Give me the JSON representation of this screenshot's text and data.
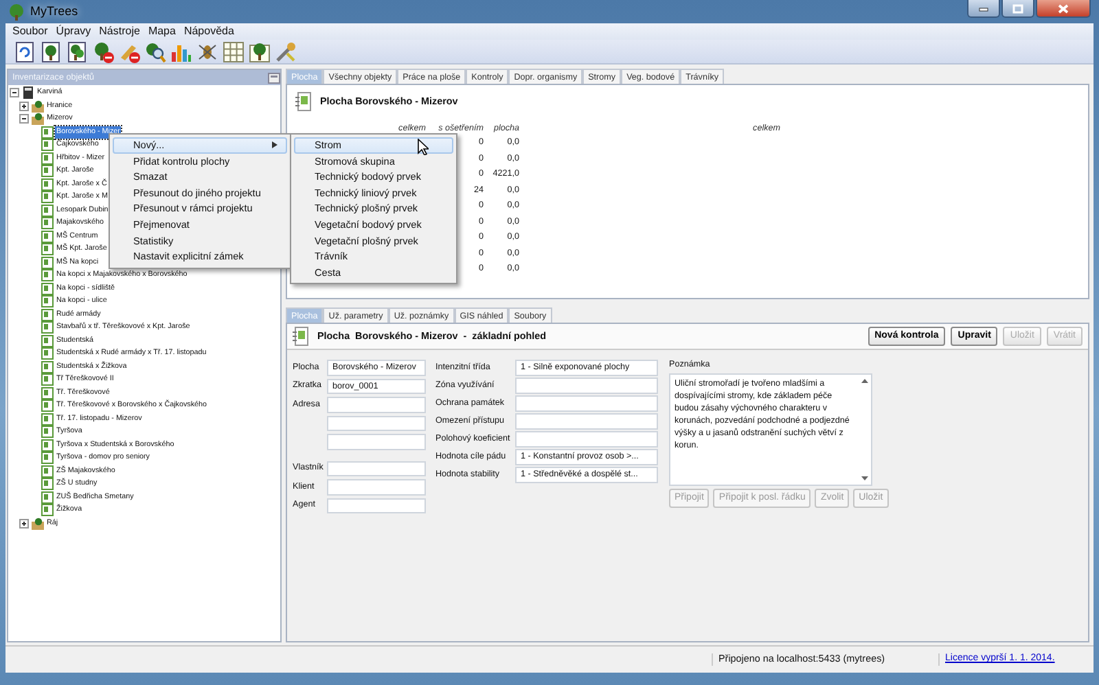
{
  "window": {
    "title": "MyTrees"
  },
  "menu_bar": [
    {
      "label": "Soubor"
    },
    {
      "label": "Úpravy"
    },
    {
      "label": "Nástroje"
    },
    {
      "label": "Mapa"
    },
    {
      "label": "Nápověda"
    }
  ],
  "tree_panel": {
    "title": "Inventarizace objektů",
    "tree": [
      {
        "label": "Karviná",
        "kind": "root",
        "expanded": true,
        "selected": false,
        "children": [
          {
            "label": "Hranice",
            "kind": "district",
            "expanded": false,
            "selected": false
          },
          {
            "label": "Mizerov",
            "kind": "district",
            "expanded": true,
            "selected": false,
            "children": [
              {
                "label": "Borovského - Mizer",
                "kind": "area",
                "selected": true
              },
              {
                "label": "Čajkovského",
                "kind": "area",
                "selected": false
              },
              {
                "label": "Hřbitov - Mizer",
                "kind": "area",
                "selected": false
              },
              {
                "label": "Kpt. Jaroše",
                "kind": "area",
                "selected": false
              },
              {
                "label": "Kpt. Jaroše x Č",
                "kind": "area",
                "selected": false
              },
              {
                "label": "Kpt. Jaroše x M",
                "kind": "area",
                "selected": false
              },
              {
                "label": "Lesopark Dubin",
                "kind": "area",
                "selected": false
              },
              {
                "label": "Majakovského",
                "kind": "area",
                "selected": false
              },
              {
                "label": "MŠ Centrum",
                "kind": "area",
                "selected": false
              },
              {
                "label": "MŠ Kpt. Jaroše",
                "kind": "area",
                "selected": false
              },
              {
                "label": "MŠ Na kopci",
                "kind": "area",
                "selected": false
              },
              {
                "label": "Na kopci x Majakovského x Borovského",
                "kind": "area",
                "selected": false
              },
              {
                "label": "Na kopci - sídliště",
                "kind": "area",
                "selected": false
              },
              {
                "label": "Na kopci - ulice",
                "kind": "area",
                "selected": false
              },
              {
                "label": "Rudé armády",
                "kind": "area",
                "selected": false
              },
              {
                "label": "Stavbařů x tř. Těreškovové x Kpt. Jaroše",
                "kind": "area",
                "selected": false
              },
              {
                "label": "Studentská",
                "kind": "area",
                "selected": false
              },
              {
                "label": "Studentská x Rudé armády x Tř. 17. listopadu",
                "kind": "area",
                "selected": false
              },
              {
                "label": "Studentská x Žižkova",
                "kind": "area",
                "selected": false
              },
              {
                "label": "Tř Těreškovové II",
                "kind": "area",
                "selected": false
              },
              {
                "label": "Tř. Těreškovové",
                "kind": "area",
                "selected": false
              },
              {
                "label": "Tř. Těreškovové x Borovského x Čajkovského",
                "kind": "area",
                "selected": false
              },
              {
                "label": "Tř. 17. listopadu - Mizerov",
                "kind": "area",
                "selected": false
              },
              {
                "label": "Tyršova",
                "kind": "area",
                "selected": false
              },
              {
                "label": "Tyršova x Studentská x Borovského",
                "kind": "area",
                "selected": false
              },
              {
                "label": "Tyršova - domov pro seniory",
                "kind": "area",
                "selected": false
              },
              {
                "label": "ZŠ Majakovského",
                "kind": "area",
                "selected": false
              },
              {
                "label": "ZŠ U studny",
                "kind": "area",
                "selected": false
              },
              {
                "label": "ZUŠ Bedřicha Smetany",
                "kind": "area",
                "selected": false
              },
              {
                "label": "Žižkova",
                "kind": "area",
                "selected": false
              }
            ]
          },
          {
            "label": "Ráj",
            "kind": "district",
            "expanded": false,
            "selected": false
          }
        ]
      }
    ]
  },
  "top_tabs": [
    {
      "label": "Plocha",
      "selected": true
    },
    {
      "label": "Všechny objekty",
      "selected": false
    },
    {
      "label": "Práce na ploše",
      "selected": false
    },
    {
      "label": "Kontroly",
      "selected": false
    },
    {
      "label": "Dopr. organismy",
      "selected": false
    },
    {
      "label": "Stromy",
      "selected": false
    },
    {
      "label": "Veg. bodové",
      "selected": false
    },
    {
      "label": "Trávníky",
      "selected": false
    }
  ],
  "area_header": {
    "title": "Plocha Borovského - Mizerov"
  },
  "summary_table": {
    "columns": [
      "celkem",
      "s ošetřením",
      "plocha"
    ],
    "column_4": "celkem",
    "rows": [
      {
        "treated": "0",
        "area": "0,0"
      },
      {
        "treated": "0",
        "area": "0,0"
      },
      {
        "treated": "0",
        "area": "4221,0"
      },
      {
        "treated": "24",
        "area": "0,0"
      },
      {
        "treated": "0",
        "area": "0,0"
      },
      {
        "treated": "0",
        "area": "0,0"
      },
      {
        "treated": "0",
        "area": "0,0"
      },
      {
        "treated": "0",
        "area": "0,0"
      },
      {
        "treated": "0",
        "area": "0,0"
      }
    ]
  },
  "context_menu": {
    "items": [
      {
        "label": "Nový...",
        "has_submenu": true,
        "selected": true
      },
      {
        "label": "Přidat kontrolu plochy",
        "has_submenu": false,
        "selected": false
      },
      {
        "label": "Smazat",
        "has_submenu": false,
        "selected": false
      },
      {
        "label": "Přesunout do jiného projektu",
        "has_submenu": false,
        "selected": false
      },
      {
        "label": "Přesunout v rámci projektu",
        "has_submenu": false,
        "selected": false
      },
      {
        "label": "Přejmenovat",
        "has_submenu": false,
        "selected": false
      },
      {
        "label": "Statistiky",
        "has_submenu": false,
        "selected": false
      },
      {
        "label": "Nastavit explicitní zámek",
        "has_submenu": false,
        "selected": false
      }
    ]
  },
  "submenu": {
    "items": [
      {
        "label": "Strom",
        "selected": true
      },
      {
        "label": "Stromová skupina",
        "selected": false
      },
      {
        "label": "Technický bodový prvek",
        "selected": false
      },
      {
        "label": "Technický liniový prvek",
        "selected": false
      },
      {
        "label": "Technický plošný prvek",
        "selected": false
      },
      {
        "label": "Vegetační bodový prvek",
        "selected": false
      },
      {
        "label": "Vegetační plošný prvek",
        "selected": false
      },
      {
        "label": "Trávník",
        "selected": false
      },
      {
        "label": "Cesta",
        "selected": false
      }
    ]
  },
  "bottom_tabs": [
    {
      "label": "Plocha",
      "selected": true
    },
    {
      "label": "Už. parametry",
      "selected": false
    },
    {
      "label": "Už. poznámky",
      "selected": false
    },
    {
      "label": "GIS náhled",
      "selected": false
    },
    {
      "label": "Soubory",
      "selected": false
    }
  ],
  "detail": {
    "title": "Plocha  Borovského - Mizerov  -  základní pohled",
    "buttons": [
      {
        "label": "Nová kontrola",
        "disabled": false
      },
      {
        "label": "Upravit",
        "disabled": false
      },
      {
        "label": "Uložit",
        "disabled": true
      },
      {
        "label": "Vrátit",
        "disabled": true
      }
    ],
    "left_fields": [
      {
        "kind": "field",
        "label": "Plocha",
        "value": "Borovského - Mizerov"
      },
      {
        "kind": "field",
        "label": "Zkratka",
        "value": "borov_0001"
      },
      {
        "kind": "field",
        "label": "Adresa"
      },
      {
        "kind": "continuation"
      },
      {
        "kind": "continuation"
      },
      {
        "kind": "spacer"
      },
      {
        "kind": "field",
        "label": "Vlastník"
      },
      {
        "kind": "field",
        "label": "Klient"
      },
      {
        "kind": "field",
        "label": "Agent"
      }
    ],
    "mid_fields": [
      {
        "label": "Intenzitní třída",
        "value": "1 - Silně exponované plochy"
      },
      {
        "label": "Zóna využívání"
      },
      {
        "label": "Ochrana památek"
      },
      {
        "label": "Omezení přístupu"
      },
      {
        "label": "Polohový koeficient"
      },
      {
        "label": "Hodnota cíle pádu",
        "value": "1 - Konstantní provoz osob >..."
      },
      {
        "label": "Hodnota stability",
        "value": "1 - Středněvěké a dospělé st..."
      }
    ],
    "note": {
      "label": "Poznámka",
      "text": "Uliční stromořadí je tvořeno mladšími a dospívajícími stromy, kde základem péče budou zásahy výchovného charakteru v korunách, pozvedání podchodné a podjezdné výšky a u jasanů odstranění suchých větví z korun.",
      "buttons": [
        {
          "label": "Připojit",
          "disabled": true
        },
        {
          "label": "Připojit k posl. řádku",
          "disabled": true
        },
        {
          "label": "Zvolit",
          "disabled": true
        },
        {
          "label": "Uložit",
          "disabled": true
        }
      ]
    }
  },
  "status_bar": {
    "connection": "Připojeno na localhost:5433 (mytrees)",
    "license_link": "Licence vyprší 1. 1. 2014."
  }
}
